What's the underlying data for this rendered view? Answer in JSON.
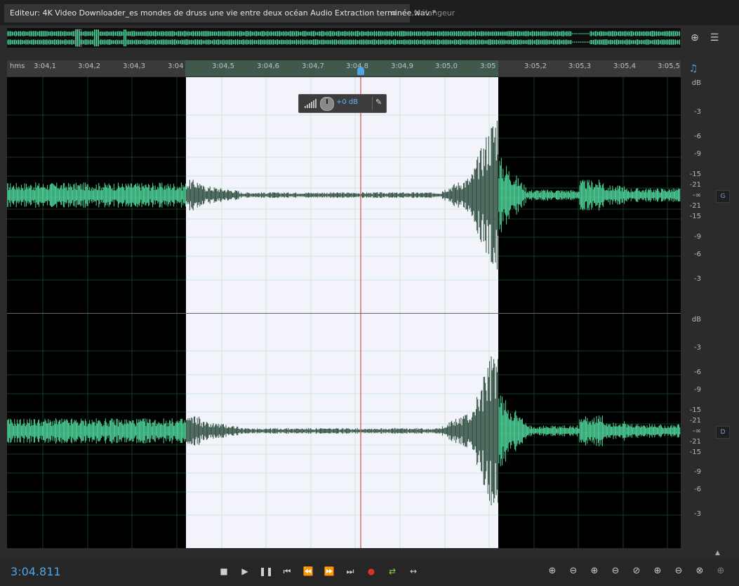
{
  "tabs": {
    "editor_title": "Editeur: 4K Video Downloader_es mondes de druss une vie entre deux océan Audio Extraction terminée.wav *",
    "menu_icon": "≡",
    "mixer_label": "Mélangeur"
  },
  "ruler": {
    "unit": "hms",
    "ticks": [
      "3:04,1",
      "3:04,2",
      "3:04,3",
      "3:04",
      "3:04,5",
      "3:04,6",
      "3:04,7",
      "3:04,8",
      "3:04,9",
      "3:05,0",
      "3:05",
      "3:05,2",
      "3:05,3",
      "3:05,4",
      "3:05,5"
    ]
  },
  "hud": {
    "gain": "+0 dB"
  },
  "channels": [
    {
      "label": "G",
      "db_labels": [
        "dB",
        "-3",
        "-6",
        "-9",
        "-15",
        "-21",
        "-∞",
        "-21",
        "-15",
        "-9",
        "-6",
        "-3"
      ]
    },
    {
      "label": "D",
      "db_labels": [
        "dB",
        "-3",
        "-6",
        "-9",
        "-15",
        "-21",
        "-∞",
        "-21",
        "-15",
        "-9",
        "-6",
        "-3"
      ]
    }
  ],
  "transport": {
    "timecode": "3:04.811"
  },
  "colors": {
    "waveform": "#4fd59a",
    "waveform_selected": "#2a4a3c",
    "selection_bg": "#f3f4fb",
    "playhead": "#c0302e",
    "timecode": "#4ea6e8"
  }
}
